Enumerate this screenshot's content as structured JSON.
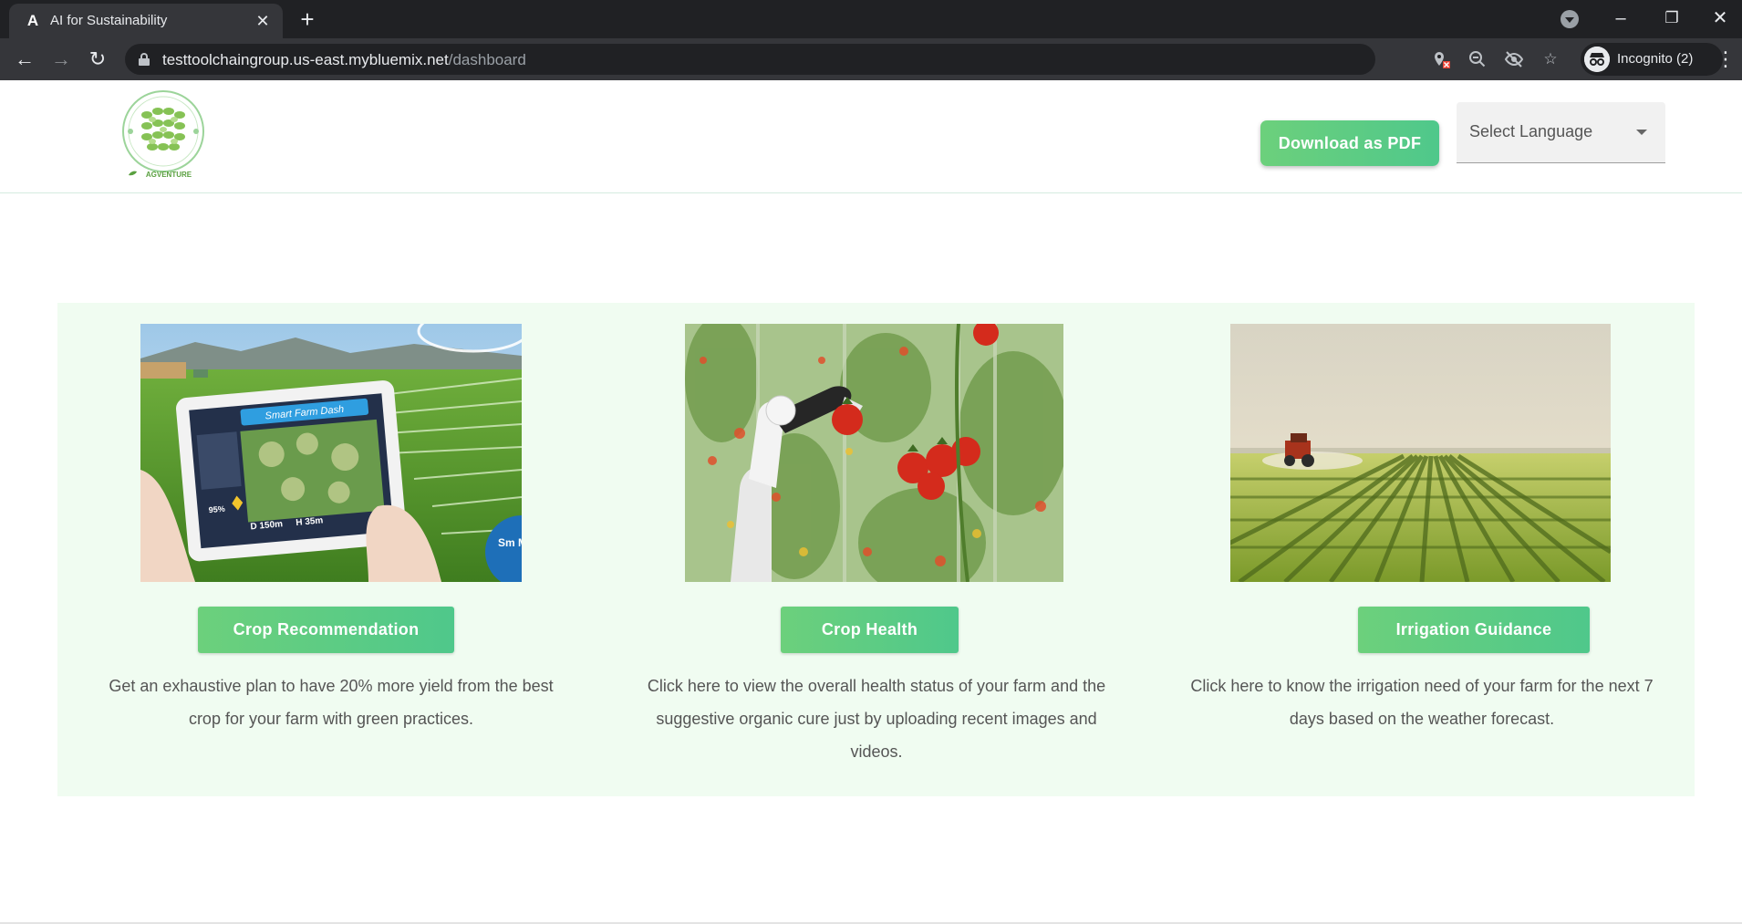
{
  "browser": {
    "tab_title": "AI for Sustainability",
    "tab_favicon": "A",
    "url_host": "testtoolchaingroup.us-east.mybluemix.net",
    "url_path": "/dashboard",
    "profile_label": "Incognito (2)",
    "icons": [
      "back-icon",
      "forward-icon",
      "reload-icon",
      "lock-icon",
      "blocked-location-icon",
      "zoom-out-icon",
      "eye-off-icon",
      "star-icon",
      "incognito-icon",
      "kebab-menu-icon",
      "tab-search-icon",
      "minimize-icon",
      "restore-icon",
      "close-icon"
    ]
  },
  "header": {
    "logo_text": "AGVENTURE",
    "download_button": "Download as PDF",
    "language_select": "Select Language"
  },
  "cards": [
    {
      "button": "Crop Recommendation",
      "description": "Get an exhaustive plan to have 20% more yield from the best crop for your farm with green practices.",
      "image_text": {
        "app_title": "Smart Farm Dash",
        "percent": "95%",
        "distance": "D 150m",
        "height": "H 35m",
        "badge": "Sm Moni"
      }
    },
    {
      "button": "Crop Health",
      "description": "Click here to view the overall health status of your farm and the suggestive organic cure just by uploading recent images and videos."
    },
    {
      "button": "Irrigation Guidance",
      "description": "Click here to know the irrigation need of your farm for the next 7 days based on the weather forecast."
    }
  ],
  "colors": {
    "accent_green": "#5bcc84",
    "section_background": "#f0fcf1",
    "browser_dark": "#202124",
    "browser_toolbar": "#35363a"
  }
}
